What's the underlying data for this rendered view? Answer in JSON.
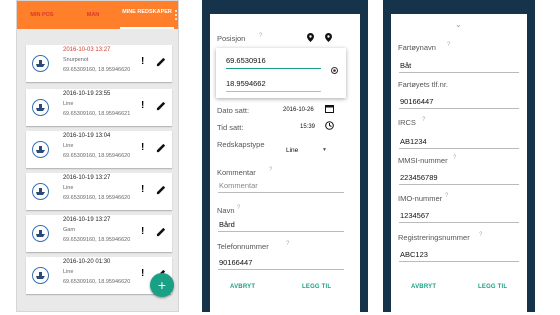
{
  "left_phone": {
    "tabs": [
      {
        "label": "MIN POS"
      },
      {
        "label": "MAN"
      },
      {
        "label": "MINE REDSKAPER"
      }
    ],
    "cards": [
      {
        "date": "2016-10-03 13:27",
        "type": "Snurpenot",
        "coords": "69.65309160, 18.95946620",
        "date_highlight": true
      },
      {
        "date": "2016-10-19 23:55",
        "type": "Line",
        "coords": "69.65309160, 18.95946621",
        "date_highlight": false
      },
      {
        "date": "2016-10-19 13:04",
        "type": "Line",
        "coords": "69.65309160, 18.95946620",
        "date_highlight": false
      },
      {
        "date": "2016-10-19 13:27",
        "type": "Line",
        "coords": "69.65309160, 18.95946620",
        "date_highlight": false
      },
      {
        "date": "2016-10-19 13:27",
        "type": "Garn",
        "coords": "69.65309160, 18.95946620",
        "date_highlight": false
      },
      {
        "date": "2016-10-20 01:30",
        "type": "Line",
        "coords": "69.65309160, 18.95946620",
        "date_highlight": false
      }
    ],
    "excl": "!",
    "fab": "+"
  },
  "middle_phone": {
    "position_label": "Posisjon",
    "lat": "69.6530916",
    "lon": "18.9594662",
    "date_label": "Dato satt:",
    "date_value": "2016-10-26",
    "time_label": "Tid satt:",
    "time_value": "15:39",
    "gear_type_label": "Redskapstype",
    "gear_type_value": "Line",
    "comment_label": "Kommentar",
    "comment_placeholder": "Kommentar",
    "name_label": "Navn",
    "name_value": "Bård",
    "phone_label": "Telefonnummer",
    "phone_value": "90166447",
    "cancel": "AVBRYT",
    "add": "LEGG TIL"
  },
  "right_phone": {
    "fields": [
      {
        "label": "Fartøynavn",
        "value": "Båt"
      },
      {
        "label": "Fartøyets tlf.nr.",
        "value": "90166447"
      },
      {
        "label": "IRCS",
        "value": "AB1234"
      },
      {
        "label": "MMSI-nummer",
        "value": "223456789"
      },
      {
        "label": "IMO-nummer",
        "value": "1234567"
      },
      {
        "label": "Registreringsnummer",
        "value": "ABC123"
      }
    ],
    "cancel": "AVBRYT",
    "add": "LEGG TIL"
  },
  "colors": {
    "accent": "#1aa084",
    "orange": "#ff7f2a",
    "dark": "#15344b",
    "red": "#d63a2c"
  }
}
